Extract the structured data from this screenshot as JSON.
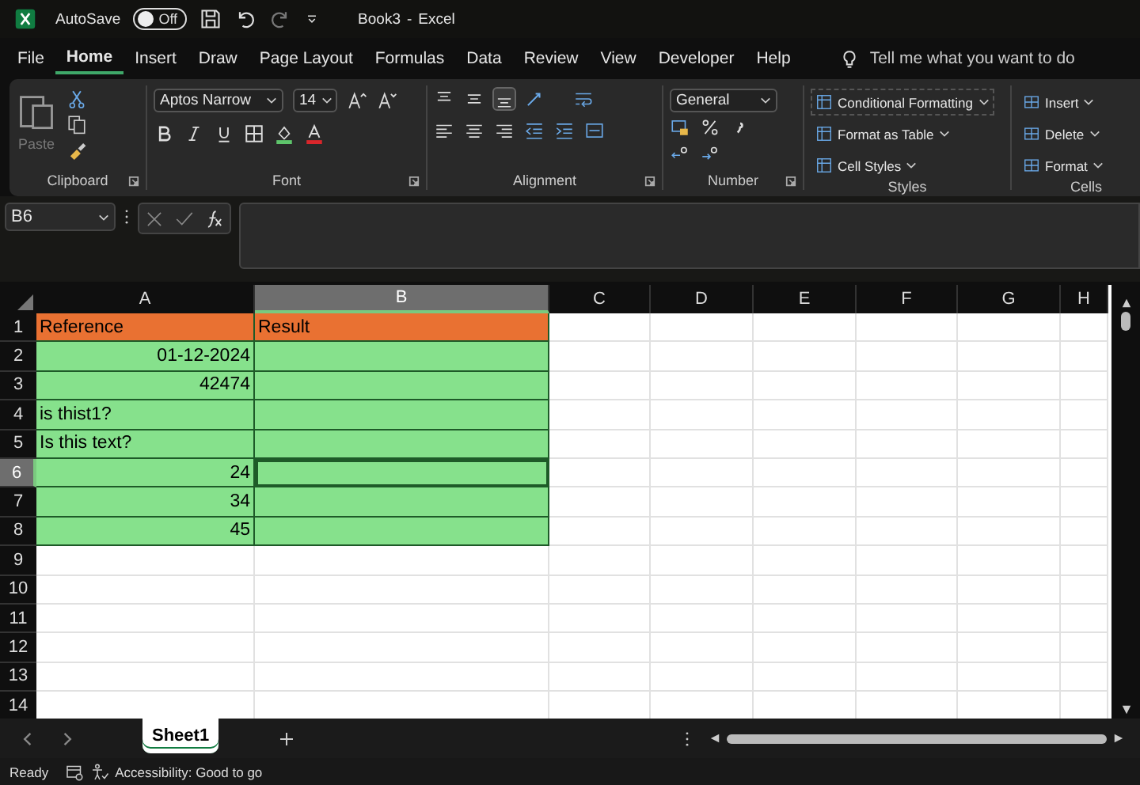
{
  "title_bar": {
    "autosave_label": "AutoSave",
    "autosave_on": false,
    "autosave_state": "Off",
    "title": "Book3",
    "separator": "-",
    "app": "Excel"
  },
  "menu_tabs": [
    {
      "label": "File",
      "selected": false
    },
    {
      "label": "Home",
      "selected": true
    },
    {
      "label": "Insert",
      "selected": false
    },
    {
      "label": "Draw",
      "selected": false
    },
    {
      "label": "Page Layout",
      "selected": false
    },
    {
      "label": "Formulas",
      "selected": false
    },
    {
      "label": "Data",
      "selected": false
    },
    {
      "label": "Review",
      "selected": false
    },
    {
      "label": "View",
      "selected": false
    },
    {
      "label": "Developer",
      "selected": false
    },
    {
      "label": "Help",
      "selected": false
    }
  ],
  "tell_me": {
    "placeholder": "Tell me what you want to do"
  },
  "ribbon": {
    "clipboard": {
      "paste_label": "Paste",
      "name": "Clipboard"
    },
    "font": {
      "font_name": "Aptos Narrow",
      "font_size": "14",
      "name": "Font"
    },
    "alignment": {
      "name": "Alignment"
    },
    "number": {
      "format": "General",
      "name": "Number"
    },
    "styles": {
      "items": [
        "Conditional Formatting",
        "Format as Table",
        "Cell Styles"
      ],
      "name": "Styles"
    },
    "cells": {
      "items": [
        "Insert",
        "Delete",
        "Format"
      ],
      "name": "Cells"
    }
  },
  "formula_bar": {
    "name_box": "B6"
  },
  "sheet": {
    "columns": [
      {
        "label": "A",
        "selected": false
      },
      {
        "label": "B",
        "selected": true
      },
      {
        "label": "C",
        "selected": false
      },
      {
        "label": "D",
        "selected": false
      },
      {
        "label": "E",
        "selected": false
      },
      {
        "label": "F",
        "selected": false
      },
      {
        "label": "G",
        "selected": false
      },
      {
        "label": "H",
        "selected": false
      }
    ],
    "rows": [
      {
        "label": "1",
        "selected": false,
        "cells": [
          {
            "text": "Reference",
            "kind": "text",
            "color": "#e97132",
            "selected": false
          },
          {
            "text": "Result",
            "kind": "text",
            "color": "#e97132",
            "selected": false
          }
        ]
      },
      {
        "label": "2",
        "selected": false,
        "cells": [
          {
            "text": "01-12-2024",
            "kind": "number",
            "color": "#86e18c",
            "selected": false
          },
          {
            "color": "#86e18c",
            "selected": false
          }
        ]
      },
      {
        "label": "3",
        "selected": false,
        "cells": [
          {
            "text": "42474",
            "kind": "number",
            "color": "#86e18c",
            "selected": false
          },
          {
            "color": "#86e18c",
            "selected": false
          }
        ]
      },
      {
        "label": "4",
        "selected": false,
        "cells": [
          {
            "text": "is thist1?",
            "kind": "text",
            "color": "#86e18c",
            "selected": false
          },
          {
            "color": "#86e18c",
            "selected": false
          }
        ]
      },
      {
        "label": "5",
        "selected": false,
        "cells": [
          {
            "text": "Is this text?",
            "kind": "text",
            "color": "#86e18c",
            "selected": false
          },
          {
            "color": "#86e18c",
            "selected": false
          }
        ]
      },
      {
        "label": "6",
        "selected": true,
        "cells": [
          {
            "text": "24",
            "kind": "number",
            "color": "#86e18c",
            "selected": false
          },
          {
            "color": "#86e18c",
            "selected": true
          }
        ]
      },
      {
        "label": "7",
        "selected": false,
        "cells": [
          {
            "text": "34",
            "kind": "number",
            "color": "#86e18c",
            "selected": false
          },
          {
            "color": "#86e18c",
            "selected": false
          }
        ]
      },
      {
        "label": "8",
        "selected": false,
        "cells": [
          {
            "text": "45",
            "kind": "number",
            "color": "#86e18c",
            "selected": false
          },
          {
            "color": "#86e18c",
            "selected": false
          }
        ]
      },
      {
        "label": "9",
        "selected": false
      },
      {
        "label": "10",
        "selected": false
      },
      {
        "label": "11",
        "selected": false
      },
      {
        "label": "12",
        "selected": false
      },
      {
        "label": "13",
        "selected": false
      },
      {
        "label": "14",
        "selected": false
      }
    ]
  },
  "sheet_tabs": [
    {
      "label": "Sheet1",
      "selected": true
    }
  ],
  "status_bar": {
    "mode": "Ready",
    "accessibility": "Accessibility: Good to go"
  }
}
